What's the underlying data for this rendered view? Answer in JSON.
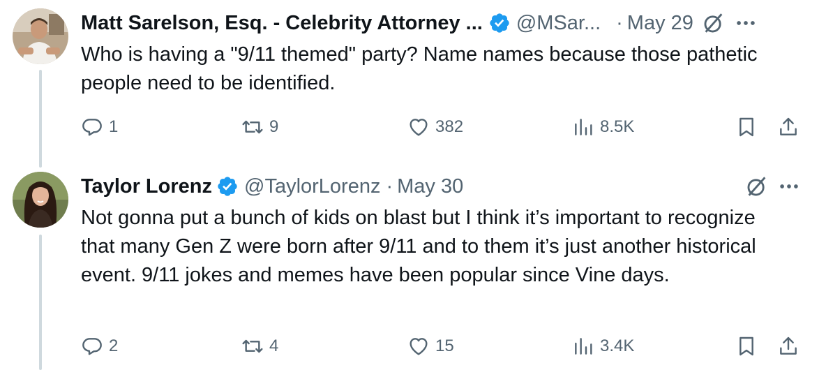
{
  "tweets": [
    {
      "author_name": "Matt Sarelson, Esq. - Celebrity Attorney ...",
      "handle": "@MSar...",
      "separator": "·",
      "date": "May 29",
      "text": "Who is having a \"9/11 themed\" party?  Name names because those pathetic people need to be identified.",
      "replies": "1",
      "retweets": "9",
      "likes": "382",
      "views": "8.5K",
      "verified": true,
      "avatar_icon": "avatar-photo-man"
    },
    {
      "author_name": "Taylor Lorenz",
      "handle": "@TaylorLorenz",
      "separator": "·",
      "date": "May 30",
      "text": "Not gonna put a bunch of kids on blast but I think it’s important to recognize that many Gen Z were born after 9/11 and to them it’s just another historical event. 9/11 jokes and memes have been popular since Vine days.",
      "replies": "2",
      "retweets": "4",
      "likes": "15",
      "views": "3.4K",
      "verified": true,
      "avatar_icon": "avatar-photo-woman"
    }
  ],
  "colors": {
    "text": "#0f1419",
    "muted": "#536471",
    "verified": "#1d9bf0",
    "thread_line": "#cfd9de"
  },
  "icons": [
    "reply-icon",
    "retweet-icon",
    "like-icon",
    "views-icon",
    "bookmark-icon",
    "share-icon",
    "grok-icon",
    "more-icon",
    "verified-badge-icon"
  ]
}
